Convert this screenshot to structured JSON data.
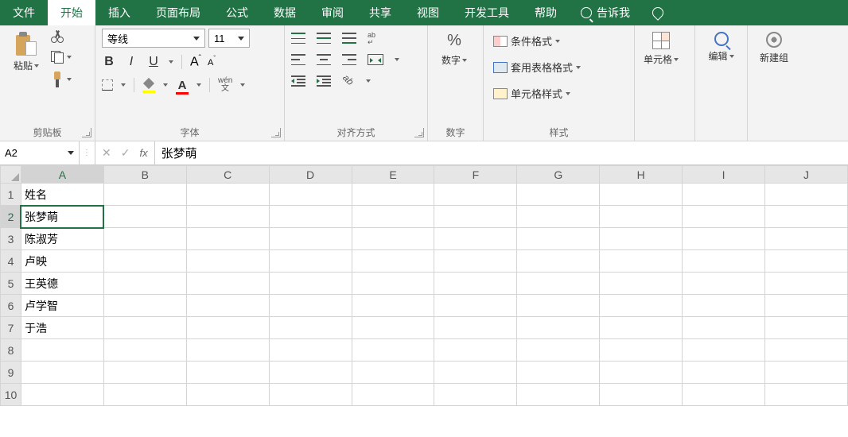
{
  "ribbon": {
    "tabs": [
      "文件",
      "开始",
      "插入",
      "页面布局",
      "公式",
      "数据",
      "审阅",
      "共享",
      "视图",
      "开发工具",
      "帮助"
    ],
    "active_tab": "开始",
    "tellme": "告诉我"
  },
  "groups": {
    "clipboard": {
      "label": "剪贴板",
      "paste": "粘贴"
    },
    "font": {
      "label": "字体",
      "name": "等线",
      "size": "11",
      "bold": "B",
      "italic": "I",
      "underline": "U",
      "wen": "wén",
      "wen2": "文"
    },
    "align": {
      "label": "对齐方式",
      "ab": "ab"
    },
    "number": {
      "label": "数字",
      "btn": "数字",
      "pct": "%"
    },
    "styles": {
      "label": "样式",
      "cond": "条件格式",
      "tablefmt": "套用表格格式",
      "cellstyle": "单元格样式"
    },
    "cells": {
      "label": "单元格"
    },
    "editing": {
      "label": "编辑"
    },
    "newgroup": {
      "label": "新建组"
    }
  },
  "formula_bar": {
    "name_box": "A2",
    "fx": "fx",
    "value": "张梦萌"
  },
  "sheet": {
    "columns": [
      "A",
      "B",
      "C",
      "D",
      "E",
      "F",
      "G",
      "H",
      "I",
      "J"
    ],
    "rows": [
      "1",
      "2",
      "3",
      "4",
      "5",
      "6",
      "7",
      "8",
      "9",
      "10"
    ],
    "active_col": "A",
    "active_row": "2",
    "cells": {
      "A1": "姓名",
      "A2": "张梦萌",
      "A3": "陈淑芳",
      "A4": "卢映",
      "A5": "王英德",
      "A6": "卢学智",
      "A7": "于浩"
    }
  }
}
